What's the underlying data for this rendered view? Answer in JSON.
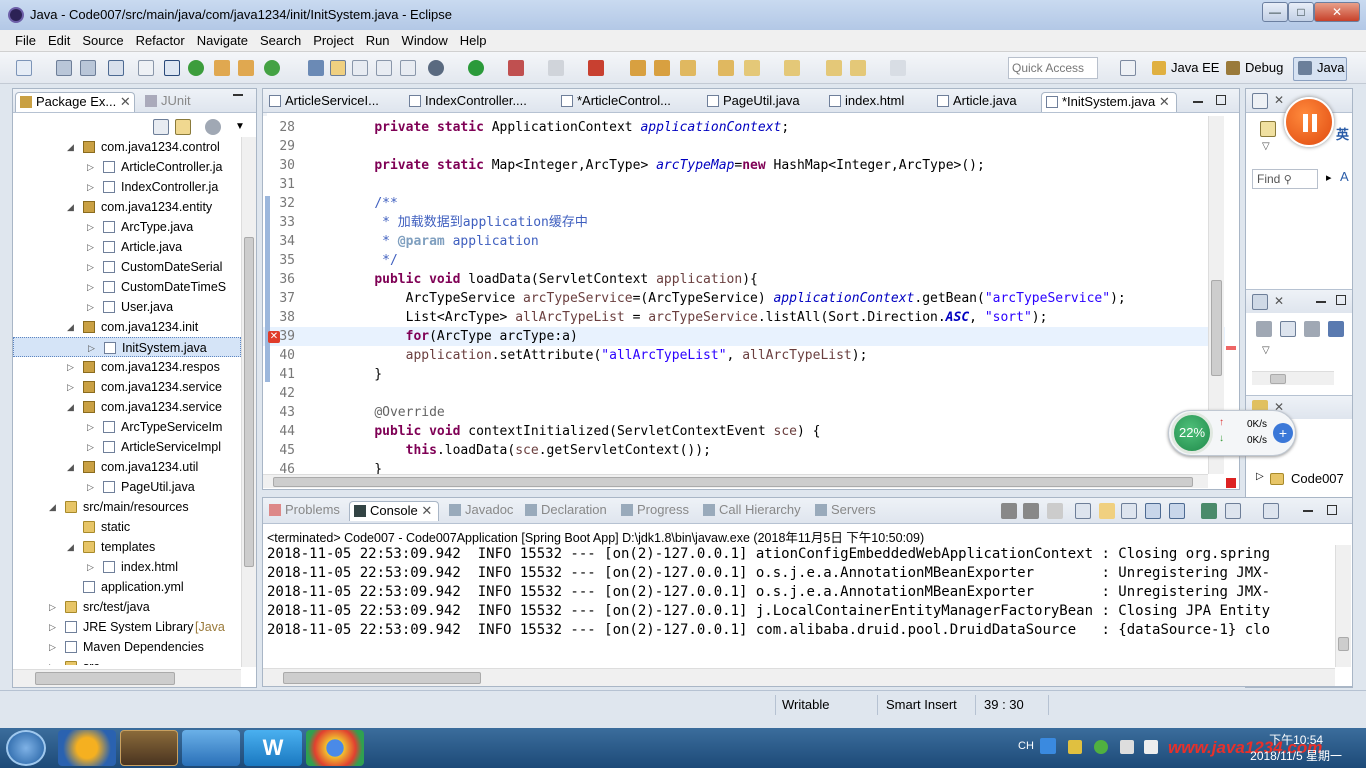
{
  "window": {
    "title": "Java - Code007/src/main/java/com/java1234/init/InitSystem.java - Eclipse",
    "minimize": "—",
    "maximize": "□",
    "close": "✕"
  },
  "menu": [
    "File",
    "Edit",
    "Source",
    "Refactor",
    "Navigate",
    "Search",
    "Project",
    "Run",
    "Window",
    "Help"
  ],
  "toolbar": {
    "quick_access_placeholder": "Quick Access",
    "perspectives": [
      "Java EE",
      "Debug",
      "Java"
    ]
  },
  "left_panel": {
    "tabs": [
      "Package Ex...",
      "JUnit"
    ],
    "tree": [
      {
        "label": "com.java1234.control",
        "icon": "package-icon",
        "level": 1,
        "expanded": true
      },
      {
        "label": "ArticleController.ja",
        "icon": "java-file-icon",
        "level": 2
      },
      {
        "label": "IndexController.ja",
        "icon": "java-file-icon",
        "level": 2
      },
      {
        "label": "com.java1234.entity",
        "icon": "package-icon",
        "level": 1,
        "expanded": true
      },
      {
        "label": "ArcType.java",
        "icon": "java-file-icon",
        "level": 2
      },
      {
        "label": "Article.java",
        "icon": "java-file-icon",
        "level": 2
      },
      {
        "label": "CustomDateSerial",
        "icon": "java-file-icon",
        "level": 2
      },
      {
        "label": "CustomDateTimeS",
        "icon": "java-file-icon",
        "level": 2
      },
      {
        "label": "User.java",
        "icon": "java-file-icon",
        "level": 2
      },
      {
        "label": "com.java1234.init",
        "icon": "package-icon",
        "level": 1,
        "expanded": true
      },
      {
        "label": "InitSystem.java",
        "icon": "java-file-icon",
        "level": 2,
        "selected": true
      },
      {
        "label": "com.java1234.respos",
        "icon": "package-icon",
        "level": 1,
        "expanded": false
      },
      {
        "label": "com.java1234.service",
        "icon": "package-icon",
        "level": 1,
        "expanded": false
      },
      {
        "label": "com.java1234.service",
        "icon": "package-icon",
        "level": 1,
        "expanded": true
      },
      {
        "label": "ArcTypeServiceIm",
        "icon": "java-file-icon",
        "level": 2
      },
      {
        "label": "ArticleServiceImpl",
        "icon": "java-file-icon",
        "level": 2
      },
      {
        "label": "com.java1234.util",
        "icon": "package-icon",
        "level": 1,
        "expanded": true
      },
      {
        "label": "PageUtil.java",
        "icon": "java-file-icon",
        "level": 2
      },
      {
        "label": "src/main/resources",
        "icon": "folder-icon",
        "level": 0,
        "expanded": true
      },
      {
        "label": "static",
        "icon": "folder-icon",
        "level": 1
      },
      {
        "label": "templates",
        "icon": "folder-icon",
        "level": 1,
        "expanded": true
      },
      {
        "label": "index.html",
        "icon": "html-file-icon",
        "level": 2
      },
      {
        "label": "application.yml",
        "icon": "yml-file-icon",
        "level": 1
      },
      {
        "label": "src/test/java",
        "icon": "folder-icon",
        "level": 0,
        "expanded": false
      },
      {
        "label": "JRE System Library",
        "suffix": "[Java",
        "icon": "library-icon",
        "level": 0,
        "expanded": false
      },
      {
        "label": "Maven Dependencies",
        "icon": "library-icon",
        "level": 0,
        "expanded": false
      },
      {
        "label": "src",
        "icon": "folder-icon",
        "level": 0,
        "expanded": false
      }
    ]
  },
  "editor": {
    "tabs": [
      "ArticleServiceI...",
      "IndexController....",
      "*ArticleControl...",
      "PageUtil.java",
      "index.html",
      "Article.java",
      "*InitSystem.java"
    ],
    "active_tab_index": 6,
    "lines": [
      {
        "n": "28",
        "html": "    <span class='kw'>private</span> <span class='kw'>static</span> ApplicationContext <span class='fld'>applicationContext</span>;"
      },
      {
        "n": "29",
        "html": ""
      },
      {
        "n": "30",
        "html": "    <span class='kw'>private</span> <span class='kw'>static</span> Map&lt;Integer,ArcType&gt; <span class='fld'>arcTypeMap</span>=<span class='kw'>new</span> HashMap&lt;Integer,ArcType&gt;();"
      },
      {
        "n": "31",
        "html": ""
      },
      {
        "n": "32",
        "html": "    <span class='cmt'>/**</span>"
      },
      {
        "n": "33",
        "html": "<span class='cmt'>     * 加载数据到application缓存中</span>"
      },
      {
        "n": "34",
        "html": "<span class='cmt'>     * </span><span class='tag'>@param</span><span class='cmt'> application</span>"
      },
      {
        "n": "35",
        "html": "<span class='cmt'>     */</span>"
      },
      {
        "n": "36",
        "html": "    <span class='kw'>public</span> <span class='kw'>void</span> loadData(ServletContext <span class='var'>application</span>){"
      },
      {
        "n": "37",
        "html": "        ArcTypeService <span class='var'>arcTypeService</span>=(ArcTypeService) <span class='fld'>applicationContext</span>.getBean(<span class='str'>\"arcTypeService\"</span>);"
      },
      {
        "n": "38",
        "html": "        List&lt;ArcType&gt; <span class='var'>allArcTypeList</span> = <span class='var'>arcTypeService</span>.listAll(Sort.Direction.<span class='const'>ASC</span>, <span class='str'>\"sort\"</span>);"
      },
      {
        "n": "39",
        "html": "        <span class='kw'>for</span>(ArcType arcType:a)",
        "current": true
      },
      {
        "n": "40",
        "html": "        <span class='var'>application</span>.setAttribute(<span class='str'>\"allArcTypeList\"</span>, <span class='var'>allArcTypeList</span>);"
      },
      {
        "n": "41",
        "html": "    }"
      },
      {
        "n": "42",
        "html": ""
      },
      {
        "n": "43",
        "html": "    <span class='ann'>@Override</span>"
      },
      {
        "n": "44",
        "html": "    <span class='kw'>public</span> <span class='kw'>void</span> contextInitialized(ServletContextEvent <span class='var'>sce</span>) {"
      },
      {
        "n": "45",
        "html": "        <span class='kw'>this</span>.loadData(<span class='var'>sce</span>.getServletContext());"
      },
      {
        "n": "46",
        "html": "    }"
      }
    ]
  },
  "right_panel": {
    "find_placeholder": "Find",
    "all_label": "A",
    "ime_label": "英",
    "outline_item": "Code007"
  },
  "monitor": {
    "percent": "22%",
    "up": "0K/s",
    "down": "0K/s"
  },
  "bottom_panel": {
    "tabs": [
      "Problems",
      "Console",
      "Javadoc",
      "Declaration",
      "Progress",
      "Call Hierarchy",
      "Servers"
    ],
    "active_tab_index": 1,
    "terminated": "<terminated> Code007 - Code007Application [Spring Boot App] D:\\jdk1.8\\bin\\javaw.exe (2018年11月5日 下午10:50:09)",
    "log": [
      "2018-11-05 22:53:09.942  INFO 15532 --- [on(2)-127.0.0.1] ationConfigEmbeddedWebApplicationContext : Closing org.spring",
      "2018-11-05 22:53:09.942  INFO 15532 --- [on(2)-127.0.0.1] o.s.j.e.a.AnnotationMBeanExporter        : Unregistering JMX-",
      "2018-11-05 22:53:09.942  INFO 15532 --- [on(2)-127.0.0.1] o.s.j.e.a.AnnotationMBeanExporter        : Unregistering JMX-",
      "2018-11-05 22:53:09.942  INFO 15532 --- [on(2)-127.0.0.1] j.LocalContainerEntityManagerFactoryBean : Closing JPA Entity",
      "2018-11-05 22:53:09.942  INFO 15532 --- [on(2)-127.0.0.1] com.alibaba.druid.pool.DruidDataSource   : {dataSource-1} clo"
    ]
  },
  "status": {
    "writable": "Writable",
    "insert_mode": "Smart Insert",
    "position": "39 : 30"
  },
  "taskbar": {
    "lang": "CH",
    "watermark": "www.java1234.com",
    "time": "下午10:54",
    "date": "2018/11/5 星期一"
  }
}
